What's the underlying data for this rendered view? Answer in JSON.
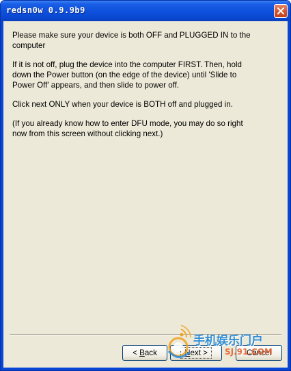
{
  "window": {
    "title": "redsn0w 0.9.9b9"
  },
  "content": {
    "paragraphs": [
      "Please make sure your device is both OFF and PLUGGED IN to the computer",
      "If it is not off, plug the device into the computer FIRST. Then, hold down the Power button (on the edge of the device) until 'Slide to Power Off' appears, and then slide to power off.",
      "Click next ONLY when your device is BOTH off and plugged in.",
      "(If you already know how to enter DFU mode, you may do so right now from this screen without clicking next.)"
    ]
  },
  "buttons": {
    "back_prefix": "< ",
    "back_mnemonic": "B",
    "back_rest": "ack",
    "next_mnemonic": "N",
    "next_rest": "ext >",
    "cancel_label": "Cancel"
  },
  "watermark": {
    "chinese": "手机娱乐门户",
    "site": "SJ.91.COM"
  },
  "icons": {
    "close": "close-icon",
    "logo": "watermark-logo-icon"
  },
  "colors": {
    "titlebar": "#0a46d6",
    "client_bg": "#ece9d8",
    "close_button": "#d5532d",
    "button_border": "#003c74"
  }
}
